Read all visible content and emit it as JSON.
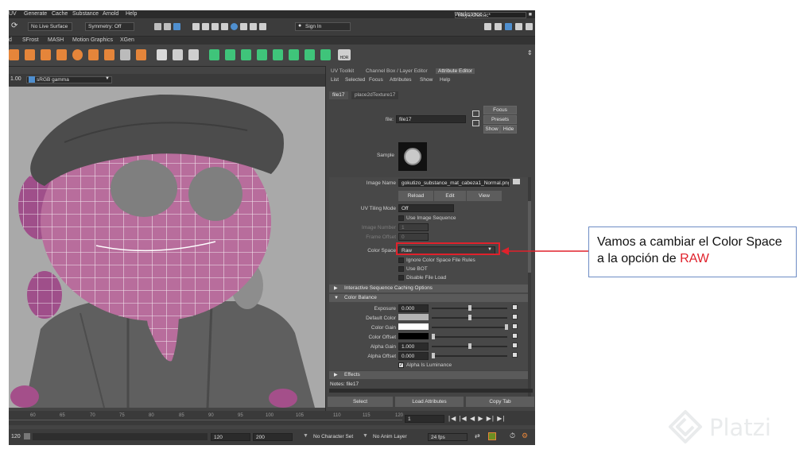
{
  "menu": {
    "items": [
      "UV",
      "Generate",
      "Cache",
      "Substance",
      "Arnold",
      "Help"
    ],
    "workspace_label": "Workspace :",
    "workspace_value": "Maya Classic*"
  },
  "status_line": {
    "live_surface": "No Live Surface",
    "symmetry": "Symmetry: Off",
    "sign_in": "Sign In"
  },
  "shelf": {
    "tabs": [
      "d",
      "SFrost",
      "MASH",
      "Motion Graphics",
      "XGen"
    ],
    "last_tool_label": "HDR"
  },
  "viewport": {
    "exposure": "1.00",
    "color_space": "sRGB gamma"
  },
  "panel_tabs": [
    "UV Toolkit",
    "Channel Box / Layer Editor",
    "Attribute Editor"
  ],
  "attribute_editor": {
    "menu": [
      "List",
      "Selected",
      "Focus",
      "Attributes",
      "Show",
      "Help"
    ],
    "node_tabs": [
      "file17",
      "place2dTexture17"
    ],
    "file_label": "file:",
    "file_value": "file17",
    "focus": "Focus",
    "presets": "Presets",
    "show": "Show",
    "hide": "Hide",
    "sample_label": "Sample",
    "image_name_label": "Image Name",
    "image_name_value": "gokutizo_substance_mat_cabeza1_Normal.png",
    "reload": "Reload",
    "edit": "Edit",
    "view": "View",
    "uv_tiling_label": "UV Tiling Mode",
    "uv_tiling_value": "Off",
    "use_image_sequence": "Use Image Sequence",
    "image_number_label": "Image Number",
    "image_number_value": "1",
    "frame_offset_label": "Frame Offset",
    "frame_offset_value": "0",
    "color_space_label": "Color Space",
    "color_space_value": "Raw",
    "ignore_rules": "Ignore Color Space File Rules",
    "use_bot": "Use BOT",
    "disable_file_load": "Disable File Load",
    "section_caching": "Interactive Sequence Caching Options",
    "section_color_balance": "Color Balance",
    "exposure_label": "Exposure",
    "exposure_value": "0.000",
    "default_color_label": "Default Color",
    "color_gain_label": "Color Gain",
    "color_offset_label": "Color Offset",
    "alpha_gain_label": "Alpha Gain",
    "alpha_gain_value": "1.000",
    "alpha_offset_label": "Alpha Offset",
    "alpha_offset_value": "0.000",
    "alpha_is_luminance": "Alpha Is Luminance",
    "section_effects": "Effects",
    "notes": "Notes: file17",
    "select": "Select",
    "load_attributes": "Load Attributes",
    "copy_tab": "Copy Tab"
  },
  "timeline": {
    "ticks": [
      "60",
      "65",
      "70",
      "75",
      "80",
      "85",
      "90",
      "95",
      "100",
      "105",
      "110",
      "115",
      "120"
    ],
    "current_frame": "1"
  },
  "range": {
    "start": "120",
    "end": "120",
    "anim_end": "200",
    "character_set": "No Character Set",
    "anim_layer": "No Anim Layer",
    "fps": "24 fps"
  },
  "callout": {
    "text_before": "Vamos a cambiar el Color Space a la opción de ",
    "highlight": "RAW"
  },
  "watermark": "Platzi",
  "colors": {
    "accent_red": "#e0212b",
    "callout_border": "#6d8cc4",
    "head_pink": "#b86d9c",
    "maya_panel": "#444444"
  }
}
